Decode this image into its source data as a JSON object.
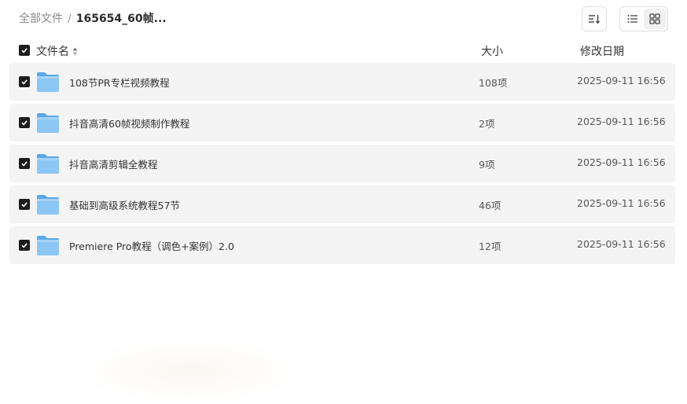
{
  "breadcrumb": {
    "root": "全部文件",
    "separator": "/",
    "current": "165654_60帧..."
  },
  "toolbar": {
    "sort_icon": "sort-icon",
    "list_view_icon": "list-view-icon",
    "grid_view_icon": "grid-view-icon"
  },
  "columns": {
    "name": "文件名",
    "size": "大小",
    "date": "修改日期"
  },
  "files": [
    {
      "name": "108节PR专栏视频教程",
      "size": "108项",
      "date": "2025-09-11 16:56",
      "checked": true,
      "icon": "folder-icon"
    },
    {
      "name": "抖音高清60帧视频制作教程",
      "size": "2项",
      "date": "2025-09-11 16:56",
      "checked": true,
      "icon": "folder-icon"
    },
    {
      "name": "抖音高清剪辑全教程",
      "size": "9项",
      "date": "2025-09-11 16:56",
      "checked": true,
      "icon": "folder-icon"
    },
    {
      "name": "基础到高级系统教程57节",
      "size": "46项",
      "date": "2025-09-11 16:56",
      "checked": true,
      "icon": "folder-icon"
    },
    {
      "name": "Premiere Pro教程（调色+案例）2.0",
      "size": "12项",
      "date": "2025-09-11 16:56",
      "checked": true,
      "icon": "folder-icon"
    }
  ],
  "colors": {
    "checkbox": "#1d1d1d",
    "row_bg": "#f4f4f4",
    "folder": "#7cbcf0"
  }
}
